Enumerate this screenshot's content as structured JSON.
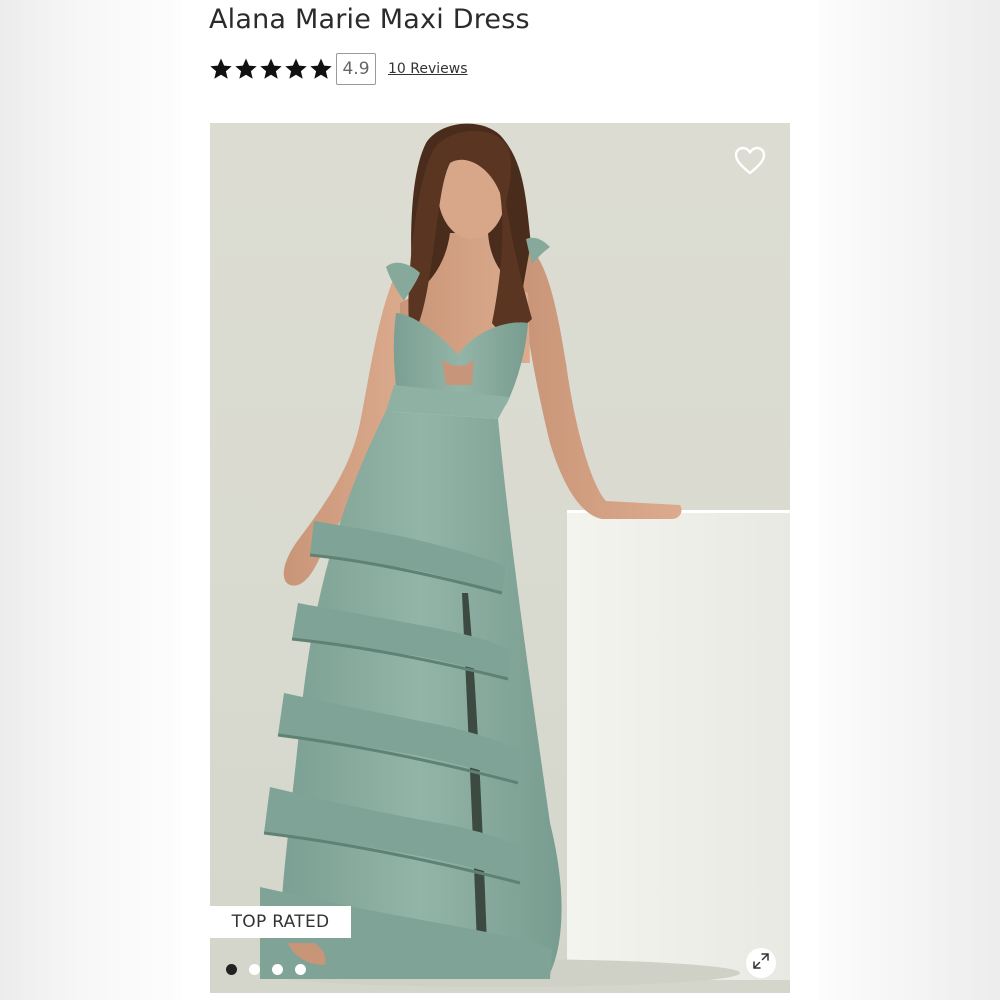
{
  "product": {
    "title": "Alana Marie Maxi Dress",
    "rating_value": "4.9",
    "stars_filled": 5,
    "stars_total": 5,
    "reviews_label": "10 Reviews"
  },
  "gallery": {
    "badge_label": "TOP RATED",
    "slide_count": 4,
    "active_slide": 1,
    "favorite_icon": "heart-outline-icon",
    "expand_icon": "expand-arrows-icon"
  },
  "colors": {
    "dress": "#86a99c",
    "background": "#dcdcd2",
    "pedestal": "#f3f3ee",
    "star": "#111111"
  }
}
